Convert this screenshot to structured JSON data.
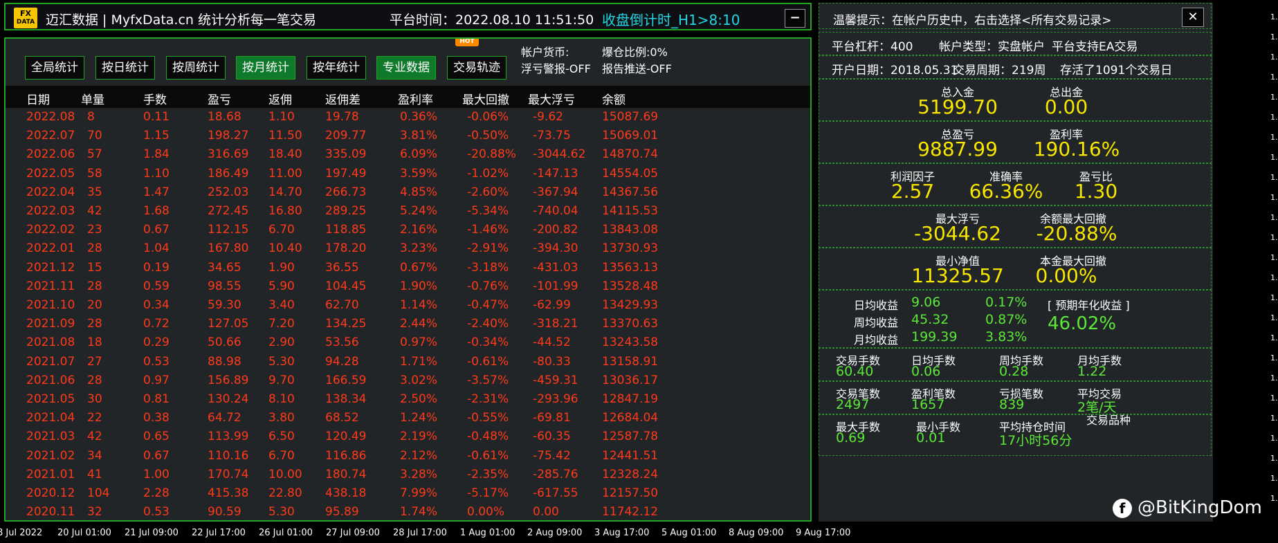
{
  "title_bar": {
    "logo_line1": "FX",
    "logo_line2": "DATA",
    "app_title": "迈汇数据 | MyfxData.cn  统计分析每一笔交易",
    "platform_time": "平台时间：2022.08.10 11:51:50",
    "countdown": "收盘倒计时_H1>8:10",
    "minimize_label": "−"
  },
  "tabs": [
    {
      "label": "全局统计",
      "active": false
    },
    {
      "label": "按日统计",
      "active": false
    },
    {
      "label": "按周统计",
      "active": false
    },
    {
      "label": "按月统计",
      "active": true
    },
    {
      "label": "按年统计",
      "active": false
    },
    {
      "label": "专业数据",
      "active": true
    },
    {
      "label": "交易轨迹",
      "active": false
    }
  ],
  "hot_badge": "HOT",
  "account_info": {
    "currency": "帐户货币:",
    "loss_alert": "浮亏警报-OFF",
    "margin_ratio": "爆仓比例:0%",
    "report_push": "报告推送-OFF"
  },
  "table": {
    "columns": [
      "日期",
      "单量",
      "手数",
      "盈亏",
      "返佣",
      "返佣差",
      "盈利率",
      "最大回撤",
      "最大浮亏",
      "余额"
    ],
    "rows": [
      [
        "2022.08",
        "8",
        "0.11",
        "18.68",
        "1.10",
        "19.78",
        "0.36%",
        "-0.06%",
        "-9.62",
        "15087.69"
      ],
      [
        "2022.07",
        "70",
        "1.15",
        "198.27",
        "11.50",
        "209.77",
        "3.81%",
        "-0.50%",
        "-73.75",
        "15069.01"
      ],
      [
        "2022.06",
        "57",
        "1.84",
        "316.69",
        "18.40",
        "335.09",
        "6.09%",
        "-20.88%",
        "-3044.62",
        "14870.74"
      ],
      [
        "2022.05",
        "58",
        "1.10",
        "186.49",
        "11.00",
        "197.49",
        "3.59%",
        "-1.02%",
        "-147.13",
        "14554.05"
      ],
      [
        "2022.04",
        "35",
        "1.47",
        "252.03",
        "14.70",
        "266.73",
        "4.85%",
        "-2.60%",
        "-367.94",
        "14367.56"
      ],
      [
        "2022.03",
        "42",
        "1.68",
        "272.45",
        "16.80",
        "289.25",
        "5.24%",
        "-5.34%",
        "-740.04",
        "14115.53"
      ],
      [
        "2022.02",
        "23",
        "0.67",
        "112.15",
        "6.70",
        "118.85",
        "2.16%",
        "-1.46%",
        "-200.82",
        "13843.08"
      ],
      [
        "2022.01",
        "28",
        "1.04",
        "167.80",
        "10.40",
        "178.20",
        "3.23%",
        "-2.91%",
        "-394.30",
        "13730.93"
      ],
      [
        "2021.12",
        "15",
        "0.19",
        "34.65",
        "1.90",
        "36.55",
        "0.67%",
        "-3.18%",
        "-431.03",
        "13563.13"
      ],
      [
        "2021.11",
        "28",
        "0.59",
        "98.55",
        "5.90",
        "104.45",
        "1.90%",
        "-0.76%",
        "-101.99",
        "13528.48"
      ],
      [
        "2021.10",
        "20",
        "0.34",
        "59.30",
        "3.40",
        "62.70",
        "1.14%",
        "-0.47%",
        "-62.99",
        "13429.93"
      ],
      [
        "2021.09",
        "28",
        "0.72",
        "127.05",
        "7.20",
        "134.25",
        "2.44%",
        "-2.40%",
        "-318.21",
        "13370.63"
      ],
      [
        "2021.08",
        "18",
        "0.29",
        "50.66",
        "2.90",
        "53.56",
        "0.97%",
        "-0.34%",
        "-44.52",
        "13243.58"
      ],
      [
        "2021.07",
        "27",
        "0.53",
        "88.98",
        "5.30",
        "94.28",
        "1.71%",
        "-0.61%",
        "-80.33",
        "13158.91"
      ],
      [
        "2021.06",
        "28",
        "0.97",
        "156.89",
        "9.70",
        "166.59",
        "3.02%",
        "-3.57%",
        "-459.31",
        "13036.17"
      ],
      [
        "2021.05",
        "30",
        "0.81",
        "130.24",
        "8.10",
        "138.34",
        "2.50%",
        "-2.31%",
        "-293.96",
        "12847.19"
      ],
      [
        "2021.04",
        "22",
        "0.38",
        "64.72",
        "3.80",
        "68.52",
        "1.24%",
        "-0.55%",
        "-69.81",
        "12684.04"
      ],
      [
        "2021.03",
        "42",
        "0.65",
        "113.99",
        "6.50",
        "120.49",
        "2.19%",
        "-0.48%",
        "-60.35",
        "12587.78"
      ],
      [
        "2021.02",
        "34",
        "0.67",
        "110.16",
        "6.70",
        "116.86",
        "2.12%",
        "-0.61%",
        "-75.42",
        "12441.51"
      ],
      [
        "2021.01",
        "41",
        "1.00",
        "170.74",
        "10.00",
        "180.74",
        "3.28%",
        "-2.35%",
        "-285.76",
        "12328.24"
      ],
      [
        "2020.12",
        "104",
        "2.28",
        "415.38",
        "22.80",
        "438.18",
        "7.99%",
        "-5.17%",
        "-617.55",
        "12157.50"
      ],
      [
        "2020.11",
        "32",
        "0.53",
        "90.59",
        "5.30",
        "95.89",
        "1.74%",
        "0.00%",
        "0.00",
        "11742.12"
      ]
    ]
  },
  "right_panel": {
    "tip": "温馨提示：在帐户历史中，右击选择<所有交易记录>",
    "close_label": "✕",
    "leverage": "平台杠杆：400",
    "account_type": "帐户类型：实盘帐户",
    "ea_support": "平台支持EA交易",
    "open_date": "开户日期：2018.05.31",
    "trade_period": "交易周期：219周",
    "survived": "存活了1091个交易日",
    "total_deposit_label": "总入金",
    "total_deposit": "5199.70",
    "total_withdraw_label": "总出金",
    "total_withdraw": "0.00",
    "total_pl_label": "总盈亏",
    "total_pl": "9887.99",
    "profit_rate_label": "盈利率",
    "profit_rate": "190.16%",
    "profit_factor_label": "利润因子",
    "profit_factor": "2.57",
    "accuracy_label": "准确率",
    "accuracy": "66.36%",
    "pl_ratio_label": "盈亏比",
    "pl_ratio": "1.30",
    "max_float_label": "最大浮亏",
    "max_float": "-3044.62",
    "max_balance_dd_label": "余额最大回撤",
    "max_balance_dd": "-20.88%",
    "min_equity_label": "最小净值",
    "min_equity": "11325.57",
    "principal_dd_label": "本金最大回撤",
    "principal_dd": "0.00%",
    "daily_avg_label": "日均收益",
    "daily_avg": "9.06",
    "daily_avg_pct": "0.17%",
    "weekly_avg_label": "周均收益",
    "weekly_avg": "45.32",
    "weekly_avg_pct": "0.87%",
    "monthly_avg_label": "月均收益",
    "monthly_avg": "199.39",
    "monthly_avg_pct": "3.83%",
    "annual_label": "[ 预期年化收益 ]",
    "annual": "46.02%",
    "trade_lots_label": "交易手数",
    "trade_lots": "60.40",
    "daily_lots_label": "日均手数",
    "daily_lots": "0.06",
    "weekly_lots_label": "周均手数",
    "weekly_lots": "0.28",
    "monthly_lots_label": "月均手数",
    "monthly_lots": "1.22",
    "trades_label": "交易笔数",
    "trades": "2497",
    "win_trades_label": "盈利笔数",
    "win_trades": "1657",
    "loss_trades_label": "亏损笔数",
    "loss_trades": "839",
    "avg_trades_label": "平均交易",
    "avg_trades": "2笔/天",
    "max_lots_label": "最大手数",
    "max_lots": "0.69",
    "min_lots_label": "最小手数",
    "min_lots": "0.01",
    "avg_hold_label": "平均持仓时间",
    "avg_hold": "17小时56分",
    "symbols_label": "交易品种"
  },
  "time_axis": [
    "8 Jul 2022",
    "20 Jul 01:00",
    "21 Jul 09:00",
    "22 Jul 17:00",
    "26 Jul 01:00",
    "27 Jul 09:00",
    "28 Jul 17:00",
    "1 Aug 01:00",
    "2 Aug 09:00",
    "3 Aug 17:00",
    "5 Aug 01:00",
    "8 Aug 09:00",
    "9 Aug 17:00"
  ],
  "watermark": "@BitKingDom",
  "price_axis_label": "1."
}
